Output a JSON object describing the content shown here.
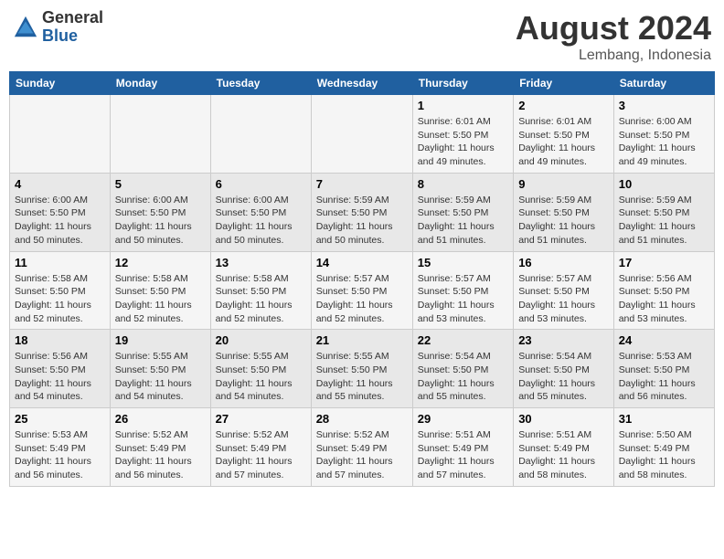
{
  "header": {
    "logo_general": "General",
    "logo_blue": "Blue",
    "title": "August 2024",
    "location": "Lembang, Indonesia"
  },
  "columns": [
    "Sunday",
    "Monday",
    "Tuesday",
    "Wednesday",
    "Thursday",
    "Friday",
    "Saturday"
  ],
  "weeks": [
    {
      "days": [
        {
          "num": "",
          "info": ""
        },
        {
          "num": "",
          "info": ""
        },
        {
          "num": "",
          "info": ""
        },
        {
          "num": "",
          "info": ""
        },
        {
          "num": "1",
          "info": "Sunrise: 6:01 AM\nSunset: 5:50 PM\nDaylight: 11 hours\nand 49 minutes."
        },
        {
          "num": "2",
          "info": "Sunrise: 6:01 AM\nSunset: 5:50 PM\nDaylight: 11 hours\nand 49 minutes."
        },
        {
          "num": "3",
          "info": "Sunrise: 6:00 AM\nSunset: 5:50 PM\nDaylight: 11 hours\nand 49 minutes."
        }
      ]
    },
    {
      "days": [
        {
          "num": "4",
          "info": "Sunrise: 6:00 AM\nSunset: 5:50 PM\nDaylight: 11 hours\nand 50 minutes."
        },
        {
          "num": "5",
          "info": "Sunrise: 6:00 AM\nSunset: 5:50 PM\nDaylight: 11 hours\nand 50 minutes."
        },
        {
          "num": "6",
          "info": "Sunrise: 6:00 AM\nSunset: 5:50 PM\nDaylight: 11 hours\nand 50 minutes."
        },
        {
          "num": "7",
          "info": "Sunrise: 5:59 AM\nSunset: 5:50 PM\nDaylight: 11 hours\nand 50 minutes."
        },
        {
          "num": "8",
          "info": "Sunrise: 5:59 AM\nSunset: 5:50 PM\nDaylight: 11 hours\nand 51 minutes."
        },
        {
          "num": "9",
          "info": "Sunrise: 5:59 AM\nSunset: 5:50 PM\nDaylight: 11 hours\nand 51 minutes."
        },
        {
          "num": "10",
          "info": "Sunrise: 5:59 AM\nSunset: 5:50 PM\nDaylight: 11 hours\nand 51 minutes."
        }
      ]
    },
    {
      "days": [
        {
          "num": "11",
          "info": "Sunrise: 5:58 AM\nSunset: 5:50 PM\nDaylight: 11 hours\nand 52 minutes."
        },
        {
          "num": "12",
          "info": "Sunrise: 5:58 AM\nSunset: 5:50 PM\nDaylight: 11 hours\nand 52 minutes."
        },
        {
          "num": "13",
          "info": "Sunrise: 5:58 AM\nSunset: 5:50 PM\nDaylight: 11 hours\nand 52 minutes."
        },
        {
          "num": "14",
          "info": "Sunrise: 5:57 AM\nSunset: 5:50 PM\nDaylight: 11 hours\nand 52 minutes."
        },
        {
          "num": "15",
          "info": "Sunrise: 5:57 AM\nSunset: 5:50 PM\nDaylight: 11 hours\nand 53 minutes."
        },
        {
          "num": "16",
          "info": "Sunrise: 5:57 AM\nSunset: 5:50 PM\nDaylight: 11 hours\nand 53 minutes."
        },
        {
          "num": "17",
          "info": "Sunrise: 5:56 AM\nSunset: 5:50 PM\nDaylight: 11 hours\nand 53 minutes."
        }
      ]
    },
    {
      "days": [
        {
          "num": "18",
          "info": "Sunrise: 5:56 AM\nSunset: 5:50 PM\nDaylight: 11 hours\nand 54 minutes."
        },
        {
          "num": "19",
          "info": "Sunrise: 5:55 AM\nSunset: 5:50 PM\nDaylight: 11 hours\nand 54 minutes."
        },
        {
          "num": "20",
          "info": "Sunrise: 5:55 AM\nSunset: 5:50 PM\nDaylight: 11 hours\nand 54 minutes."
        },
        {
          "num": "21",
          "info": "Sunrise: 5:55 AM\nSunset: 5:50 PM\nDaylight: 11 hours\nand 55 minutes."
        },
        {
          "num": "22",
          "info": "Sunrise: 5:54 AM\nSunset: 5:50 PM\nDaylight: 11 hours\nand 55 minutes."
        },
        {
          "num": "23",
          "info": "Sunrise: 5:54 AM\nSunset: 5:50 PM\nDaylight: 11 hours\nand 55 minutes."
        },
        {
          "num": "24",
          "info": "Sunrise: 5:53 AM\nSunset: 5:50 PM\nDaylight: 11 hours\nand 56 minutes."
        }
      ]
    },
    {
      "days": [
        {
          "num": "25",
          "info": "Sunrise: 5:53 AM\nSunset: 5:49 PM\nDaylight: 11 hours\nand 56 minutes."
        },
        {
          "num": "26",
          "info": "Sunrise: 5:52 AM\nSunset: 5:49 PM\nDaylight: 11 hours\nand 56 minutes."
        },
        {
          "num": "27",
          "info": "Sunrise: 5:52 AM\nSunset: 5:49 PM\nDaylight: 11 hours\nand 57 minutes."
        },
        {
          "num": "28",
          "info": "Sunrise: 5:52 AM\nSunset: 5:49 PM\nDaylight: 11 hours\nand 57 minutes."
        },
        {
          "num": "29",
          "info": "Sunrise: 5:51 AM\nSunset: 5:49 PM\nDaylight: 11 hours\nand 57 minutes."
        },
        {
          "num": "30",
          "info": "Sunrise: 5:51 AM\nSunset: 5:49 PM\nDaylight: 11 hours\nand 58 minutes."
        },
        {
          "num": "31",
          "info": "Sunrise: 5:50 AM\nSunset: 5:49 PM\nDaylight: 11 hours\nand 58 minutes."
        }
      ]
    }
  ]
}
